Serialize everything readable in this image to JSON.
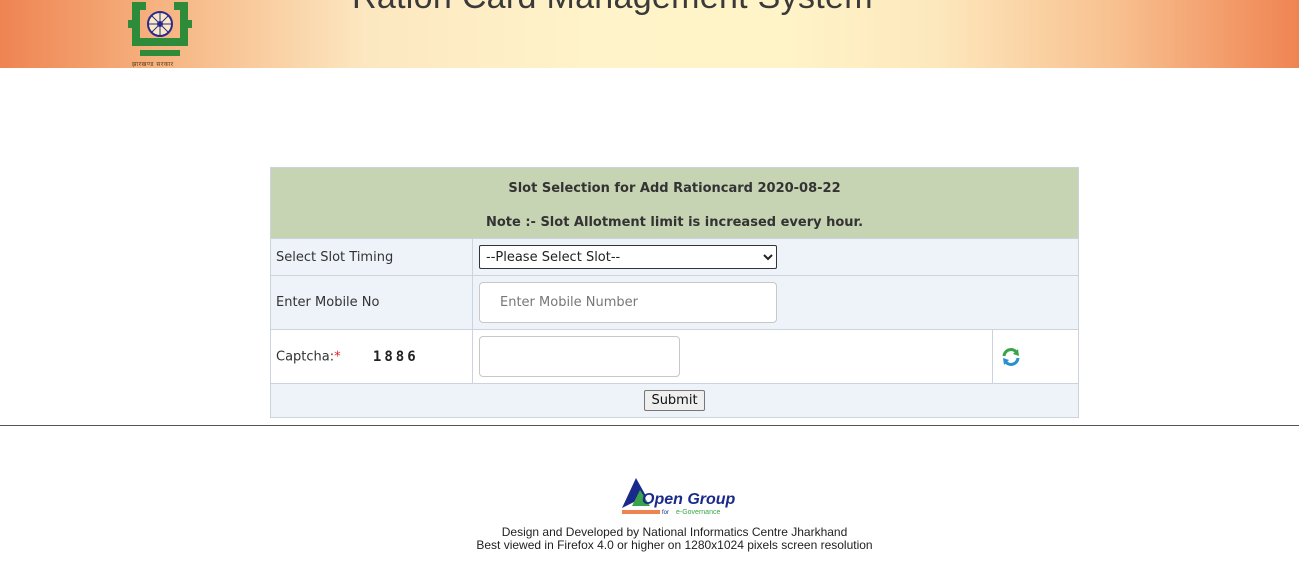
{
  "header": {
    "title": "Ration Card Management System",
    "emblem_caption": "झारखण्ड सरकार"
  },
  "form": {
    "heading": "Slot Selection for Add Rationcard 2020-08-22",
    "note": "Note :- Slot Allotment limit is increased every hour.",
    "slot_label": "Select Slot Timing",
    "slot_selected": "--Please Select Slot--",
    "mobile_label": "Enter Mobile No",
    "mobile_placeholder": "Enter Mobile Number",
    "captcha_label": "Captcha:",
    "captcha_required_mark": "*",
    "captcha_code": "1886",
    "captcha_value": "",
    "submit_label": "Submit"
  },
  "footer": {
    "logo_text": "Open Group",
    "logo_subtext_for": "for",
    "logo_subtext": "e-Governance",
    "line1": "Design and Developed by National Informatics Centre Jharkhand",
    "line2": "Best viewed in Firefox 4.0 or higher on 1280x1024 pixels screen resolution"
  },
  "colors": {
    "header_accent": "#ee8452",
    "form_heading_bg": "#c7d4b3",
    "row_bg": "#eef3fa",
    "required": "#e02020"
  },
  "icons": {
    "emblem": "jharkhand-emblem-icon",
    "refresh": "refresh-captcha-icon",
    "logo": "open-group-logo-icon"
  }
}
